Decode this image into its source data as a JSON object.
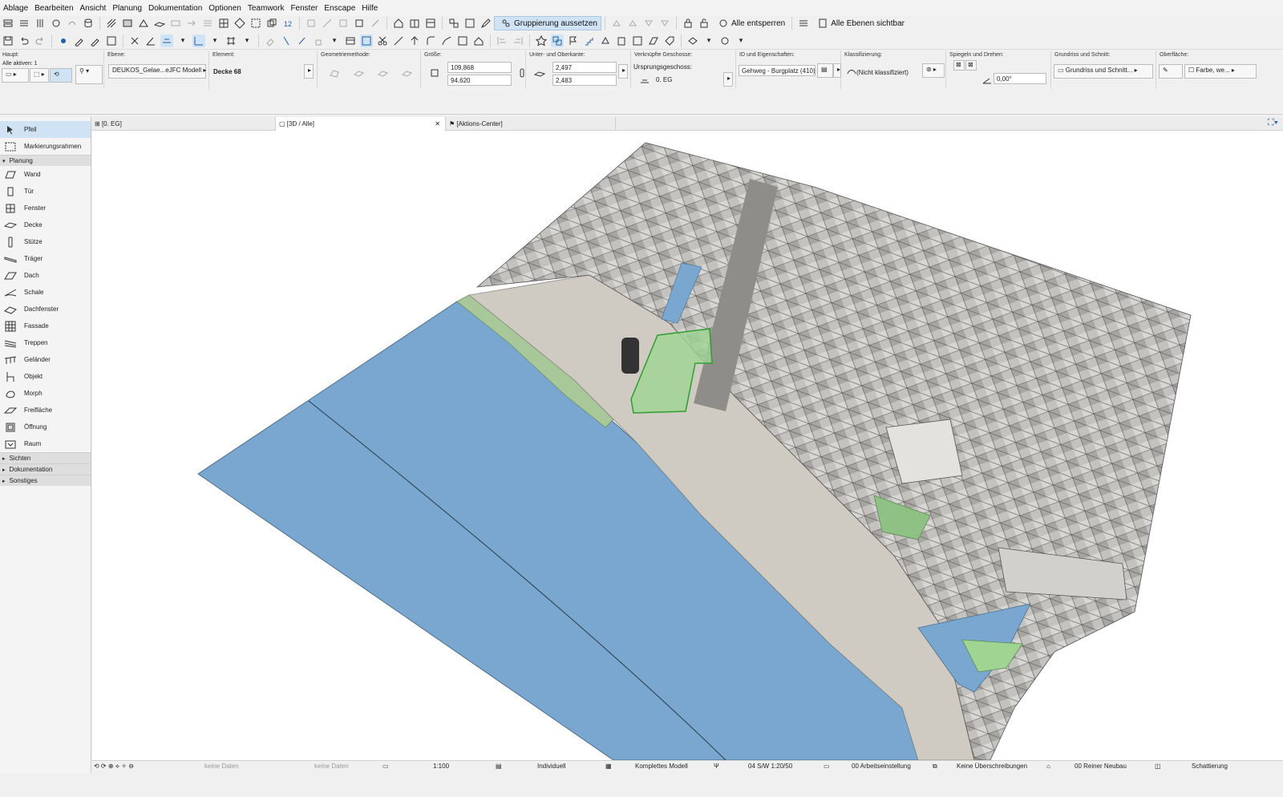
{
  "menu": [
    "Ablage",
    "Bearbeiten",
    "Ansicht",
    "Planung",
    "Dokumentation",
    "Optionen",
    "Teamwork",
    "Fenster",
    "Enscape",
    "Hilfe"
  ],
  "toolbar": {
    "group_pause_label": "Gruppierung aussetzen",
    "unlock_all_label": "Alle entsperren",
    "all_layers_visible_label": "Alle Ebenen sichtbar"
  },
  "infobox": {
    "main_header": "Haupt:",
    "main_sub": "Alle aktiven: 1",
    "layer_header": "Ebene:",
    "layer_value": "DEUKOS_Gelae...eJFC Modell",
    "element_header": "Element:",
    "element_value": "Decke 68",
    "geometry_header": "Geometriemethode:",
    "size_header": "Größe:",
    "size_x": "109,868",
    "size_y": "94,620",
    "edges_header": "Unter- und Oberkante:",
    "edge_top": "2,497",
    "edge_bottom": "2,483",
    "linked_header": "Verknüpfte Geschosse:",
    "home_story_label": "Ursprungsgeschoss:",
    "home_story_value": "0. EG",
    "id_header": "ID und Eigenschaften:",
    "id_value": "Gehweg - Burgplatz (410)",
    "class_header": "Klassifizierung:",
    "class_value": "(Nicht klassifiziert)",
    "mirror_header": "Spiegeln und Drehen:",
    "angle_value": "0,00°",
    "plan_section_header": "Grundriss und Schnitt:",
    "plan_section_value": "Grundriss und Schnitt...",
    "surface_header": "Oberfläche:",
    "surface_value": "Farbe, we..."
  },
  "tabs": {
    "plan": "[0. EG]",
    "view3d": "[3D / Alle]",
    "action_center": "[Aktions-Center]"
  },
  "sidebar": {
    "top": [
      "Pfeil",
      "Markierungsrahmen"
    ],
    "group_planung": "Planung",
    "planung_items": [
      "Wand",
      "Tür",
      "Fenster",
      "Decke",
      "Stütze",
      "Träger",
      "Dach",
      "Schale",
      "Dachfenster",
      "Fassade",
      "Treppen",
      "Geländer",
      "Objekt",
      "Morph",
      "Freifläche",
      "Öffnung",
      "Raum"
    ],
    "groups_bottom": [
      "Sichten",
      "Dokumentation",
      "Sonstiges"
    ]
  },
  "statusbar": {
    "nodata1": "keine Daten",
    "nodata2": "keine Daten",
    "scale": "1:100",
    "layer_combo": "Individuell",
    "model_view": "Komplettes Modell",
    "pen_set": "04 S/W 1:20/50",
    "work_env": "00 Arbeitseinstellung",
    "overrides": "Keine Überschreibungen",
    "renovation": "00 Reiner Neubau",
    "shading": "Schattierung"
  },
  "colors": {
    "water": "#7aa7cf",
    "grass": "#86c07a",
    "selected_slab": "#9fd493",
    "buildings": "#b8b6b3",
    "accent": "#cfe3f5"
  }
}
